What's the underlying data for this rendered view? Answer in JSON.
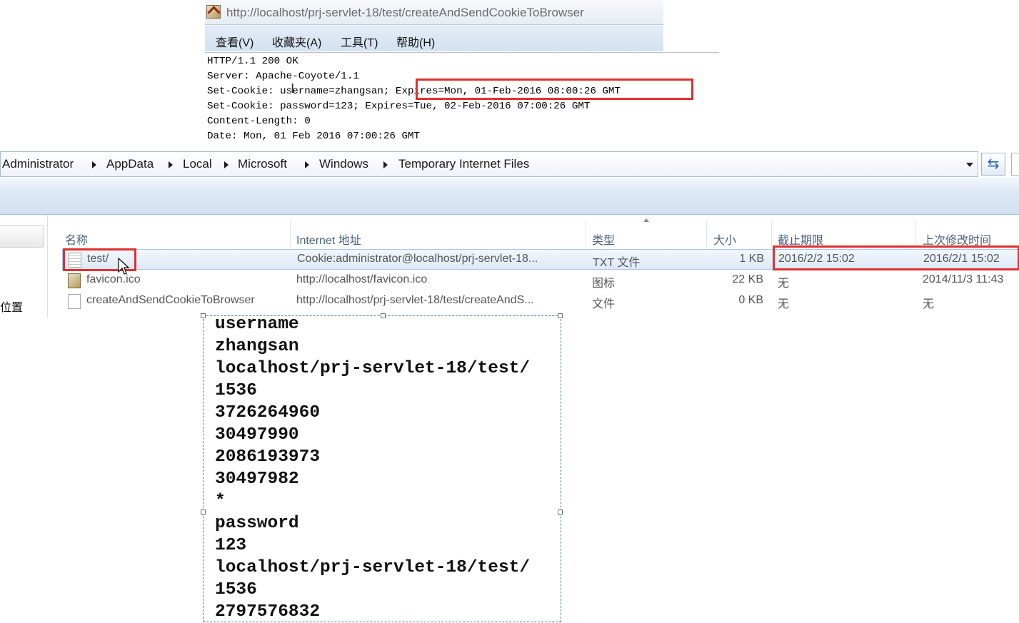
{
  "ie_window": {
    "address_url": "http://localhost/prj-servlet-18/test/createAndSendCookieToBrowser",
    "menu": [
      "查看(V)",
      "收藏夹(A)",
      "工具(T)",
      "帮助(H)"
    ],
    "http_response": [
      "HTTP/1.1 200 OK",
      "Server: Apache-Coyote/1.1",
      "Set-Cookie: username=zhangsan; Expires=Mon, 01-Feb-2016 08:00:26 GMT",
      "Set-Cookie: password=123; Expires=Tue, 02-Feb-2016 07:00:26 GMT",
      "Content-Length: 0",
      "Date: Mon, 01 Feb 2016 07:00:26 GMT"
    ]
  },
  "explorer": {
    "breadcrumb": [
      "Administrator",
      "AppData",
      "Local",
      "Microsoft",
      "Windows",
      "Temporary Internet Files"
    ],
    "refresh_icon": "refresh-icon",
    "nav_location": "位置",
    "columns": {
      "name": "名称",
      "internet_address": "Internet 地址",
      "type": "类型",
      "size": "大小",
      "expires": "截止期限",
      "last_modified": "上次修改时间"
    },
    "files": [
      {
        "name": "test/",
        "address": "Cookie:administrator@localhost/prj-servlet-18...",
        "type": "TXT 文件",
        "size": "1 KB",
        "expires": "2016/2/2 15:02",
        "modified": "2016/2/1 15:02",
        "icon": "text-file-icon"
      },
      {
        "name": "favicon.ico",
        "address": "http://localhost/favicon.ico",
        "type": "图标",
        "size": "22 KB",
        "expires": "无",
        "modified": "2014/11/3 11:43",
        "icon": "favicon-file-icon"
      },
      {
        "name": "createAndSendCookieToBrowser",
        "address": "http://localhost/prj-servlet-18/test/createAndS...",
        "type": "文件",
        "size": "0 KB",
        "expires": "无",
        "modified": "无",
        "icon": "blank-file-icon"
      }
    ]
  },
  "cookie_file_lines": [
    "username",
    "zhangsan",
    "localhost/prj-servlet-18/test/",
    "1536",
    "3726264960",
    "30497990",
    "2086193973",
    "30497982",
    "*",
    "password",
    "123",
    "localhost/prj-servlet-18/test/",
    "1536",
    "2797576832"
  ],
  "colors": {
    "highlight_red": "#e03030",
    "toolbar_blue": "#dce7f4",
    "selection_blue": "#dde9f7"
  }
}
